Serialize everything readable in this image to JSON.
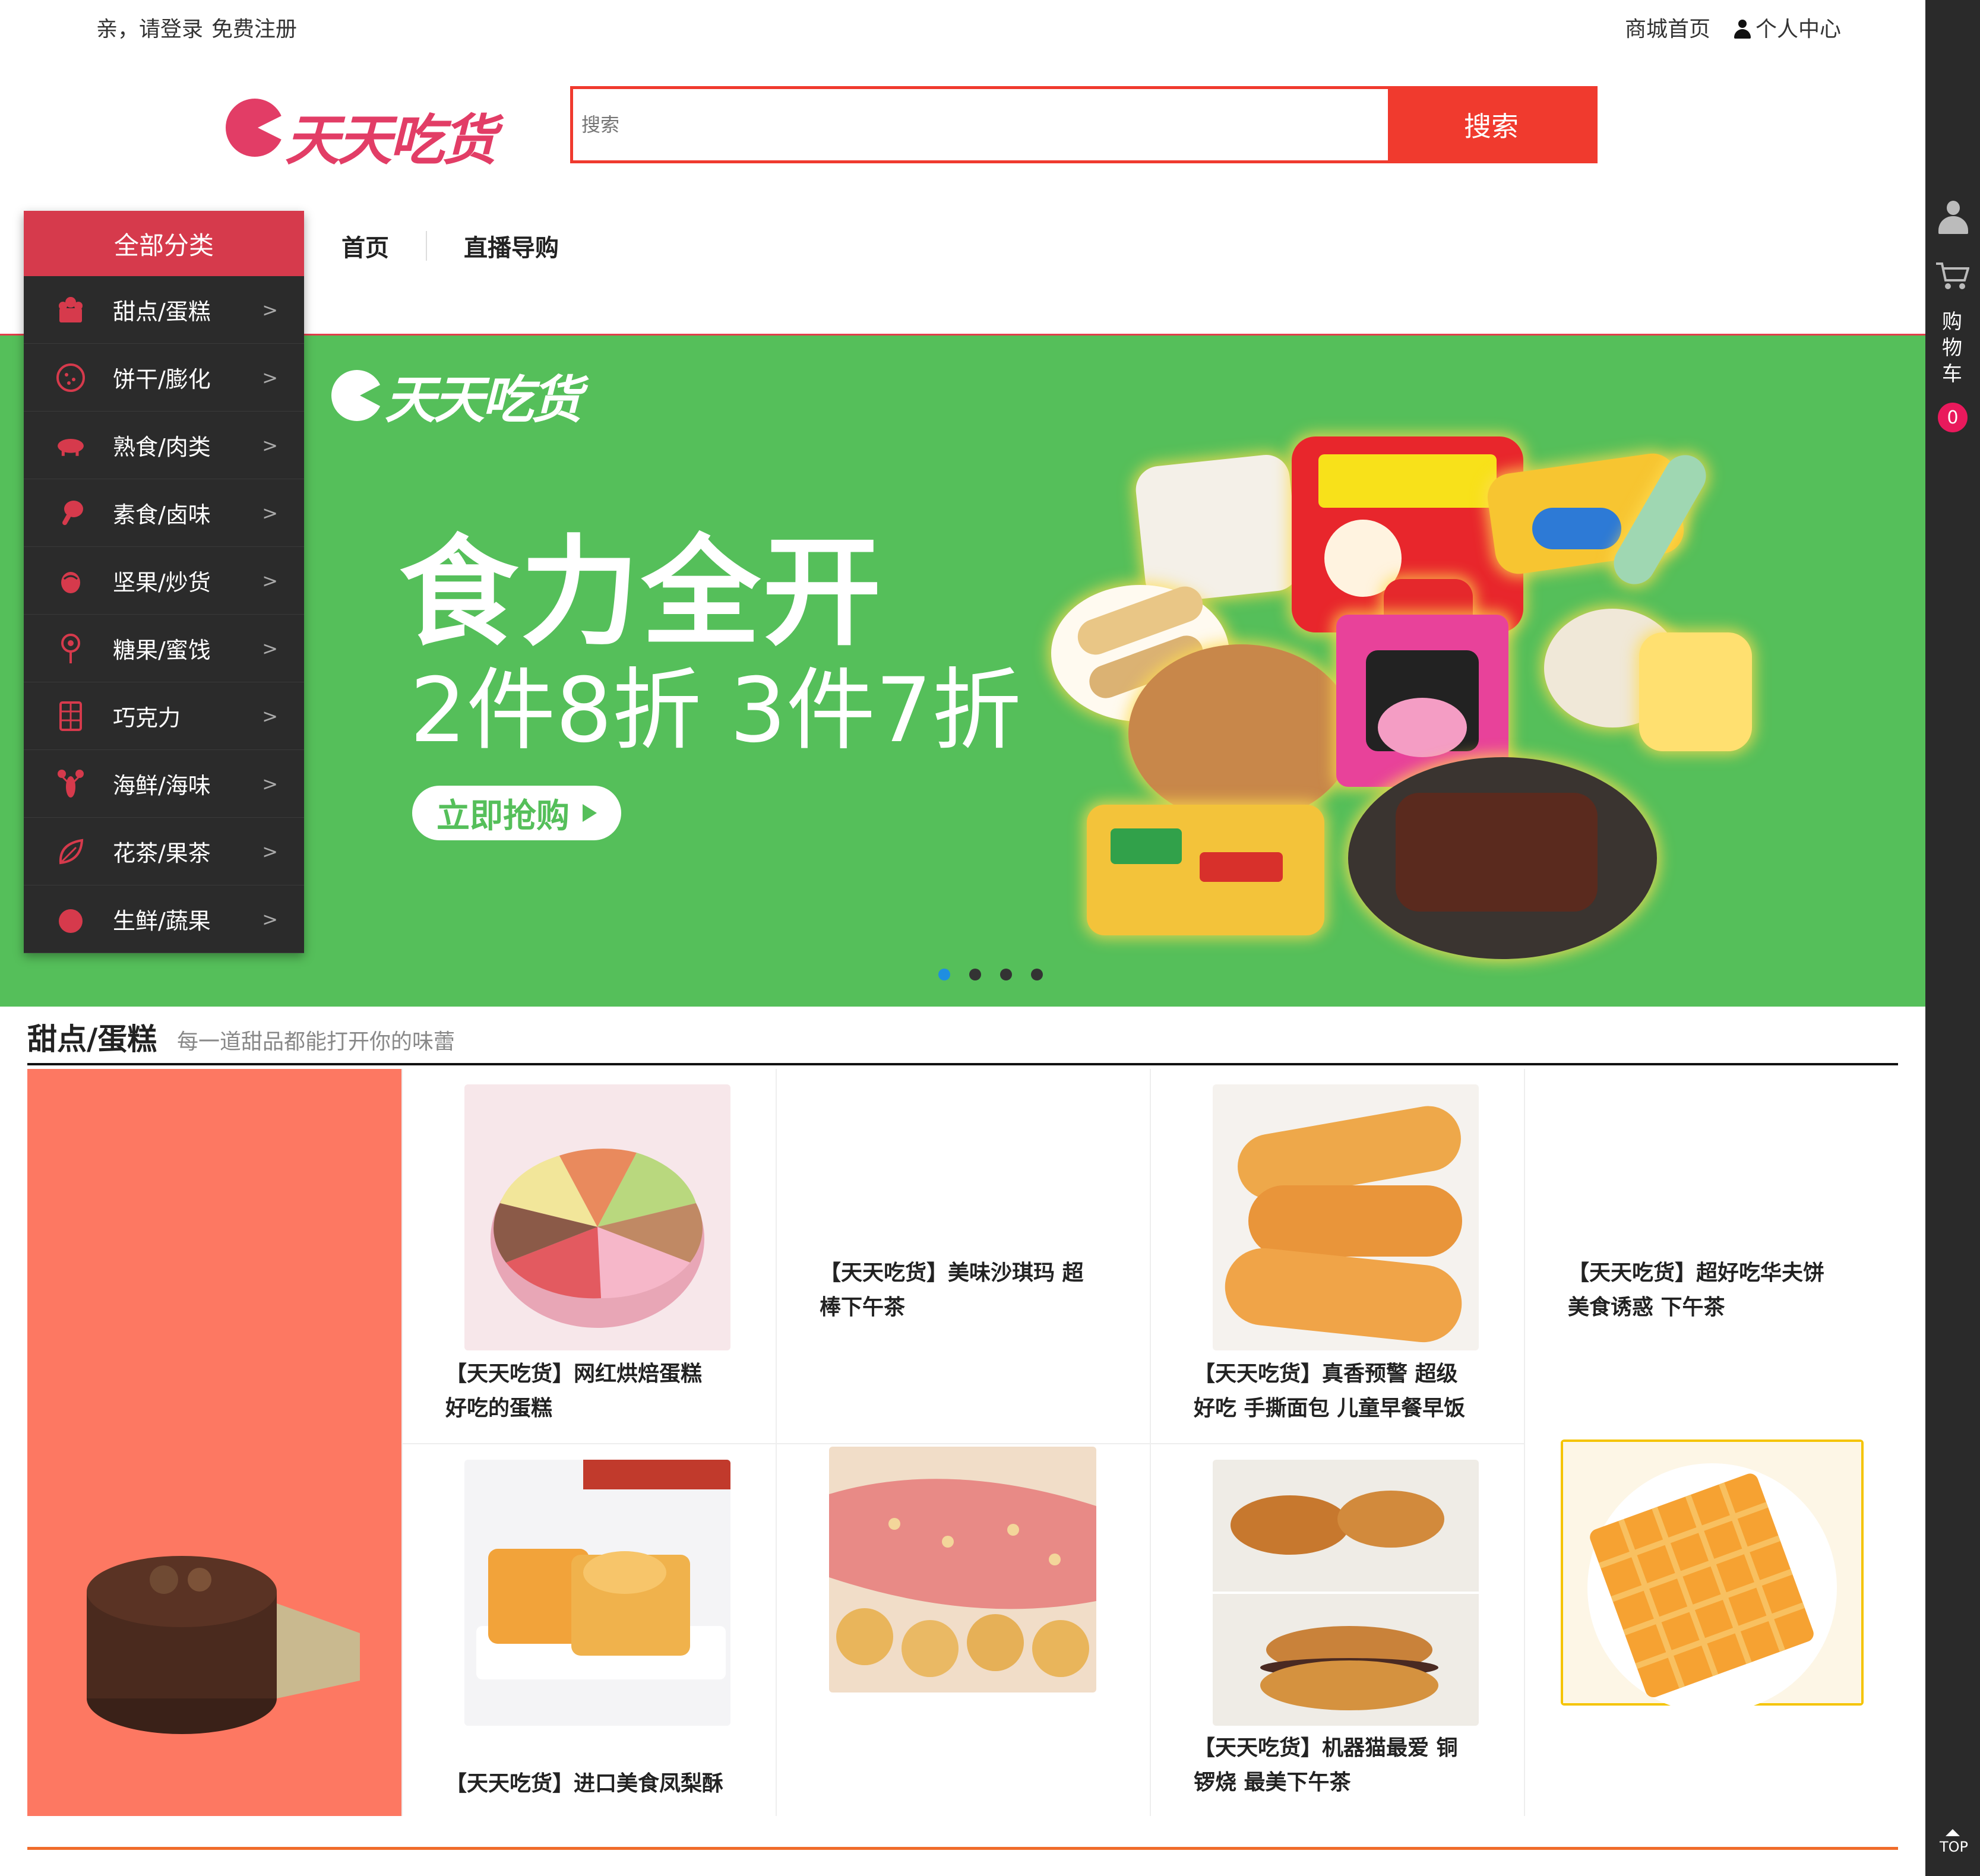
{
  "topbar": {
    "greeting": "亲，请登录",
    "register": "免费注册",
    "home_link": "商城首页",
    "user_center": "个人中心"
  },
  "logo": {
    "text": "天天吃货"
  },
  "search": {
    "placeholder": "搜索",
    "button": "搜索"
  },
  "nav": {
    "all_categories": "全部分类",
    "items": [
      "首页",
      "直播导购"
    ]
  },
  "categories": [
    {
      "label": "甜点/蛋糕",
      "icon": "cake-icon"
    },
    {
      "label": "饼干/膨化",
      "icon": "cookie-icon"
    },
    {
      "label": "熟食/肉类",
      "icon": "pig-icon"
    },
    {
      "label": "素食/卤味",
      "icon": "drumstick-icon"
    },
    {
      "label": "坚果/炒货",
      "icon": "nut-icon"
    },
    {
      "label": "糖果/蜜饯",
      "icon": "lollipop-icon"
    },
    {
      "label": "巧克力",
      "icon": "chocolate-icon"
    },
    {
      "label": "海鲜/海味",
      "icon": "lobster-icon"
    },
    {
      "label": "花茶/果茶",
      "icon": "leaf-icon"
    },
    {
      "label": "生鲜/蔬果",
      "icon": "tomato-icon"
    }
  ],
  "category_chevron": ">",
  "banner": {
    "brand": "天天吃货",
    "headline": "食力全开",
    "subline": "2件8折 3件7折",
    "cta": "立即抢购",
    "slides": 4,
    "active_slide": 1
  },
  "section": {
    "title": "甜点/蛋糕",
    "subtitle": "每一道甜品都能打开你的味蕾",
    "products": [
      {
        "name": "【天天吃货】网红烘焙蛋糕 好吃的蛋糕"
      },
      {
        "name": "【天天吃货】美味沙琪玛 超棒下午茶"
      },
      {
        "name": "【天天吃货】真香预警 超级好吃 手撕面包 儿童早餐早饭"
      },
      {
        "name": "【天天吃货】超好吃华夫饼 美食诱惑 下午茶"
      },
      {
        "name": "【天天吃货】进口美食凤梨酥"
      },
      {
        "name": "【天天吃货】机器猫最爱 铜锣烧 最美下午茶"
      }
    ]
  },
  "sidebar": {
    "cart_label": "购物车",
    "cart_count": "0",
    "top_label": "TOP"
  },
  "colors": {
    "brand": "#e23d66",
    "search_red": "#f03a2e",
    "banner_green": "#55bf5a",
    "feature_bg": "#fd7862"
  }
}
